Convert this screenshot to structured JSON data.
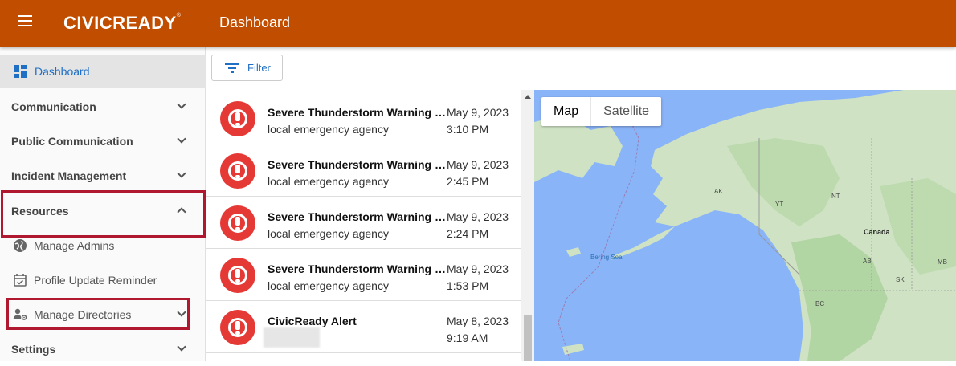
{
  "header": {
    "logo_text": "CIVICREADY",
    "logo_mark": "®",
    "page_title": "Dashboard",
    "bar_color": "#c14d00"
  },
  "sidebar": {
    "items": [
      {
        "label": "Dashboard",
        "type": "active",
        "icon": "dashboard-icon"
      },
      {
        "label": "Communication",
        "type": "section",
        "chevron": "down"
      },
      {
        "label": "Public Communication",
        "type": "section",
        "chevron": "down"
      },
      {
        "label": "Incident Management",
        "type": "section",
        "chevron": "down"
      },
      {
        "label": "Resources",
        "type": "section",
        "chevron": "up",
        "highlighted": true
      },
      {
        "label": "Manage Admins",
        "type": "sub",
        "icon": "globe-icon"
      },
      {
        "label": "Profile Update Reminder",
        "type": "sub",
        "icon": "calendar-check-icon"
      },
      {
        "label": "Manage Directories",
        "type": "sub",
        "icon": "user-gear-icon",
        "chevron": "down",
        "highlighted": true
      },
      {
        "label": "Settings",
        "type": "section",
        "chevron": "down"
      }
    ]
  },
  "toolbar": {
    "filter_label": "Filter",
    "accent": "#1f6fc5"
  },
  "alerts": [
    {
      "title": "Severe Thunderstorm Warning is…",
      "sender": "local emergency agency",
      "date": "May 9, 2023",
      "time": "3:10 PM"
    },
    {
      "title": "Severe Thunderstorm Warning is…",
      "sender": "local emergency agency",
      "date": "May 9, 2023",
      "time": "2:45 PM"
    },
    {
      "title": "Severe Thunderstorm Warning is…",
      "sender": "local emergency agency",
      "date": "May 9, 2023",
      "time": "2:24 PM"
    },
    {
      "title": "Severe Thunderstorm Warning is…",
      "sender": "local emergency agency",
      "date": "May 9, 2023",
      "time": "1:53 PM"
    },
    {
      "title": "CivicReady Alert",
      "sender": "",
      "date": "May 8, 2023",
      "time": "9:19 AM",
      "sender_redacted": true
    }
  ],
  "map": {
    "toggle_map": "Map",
    "toggle_satellite": "Satellite",
    "labels": {
      "ak": "AK",
      "yt": "YT",
      "nt": "NT",
      "bc": "BC",
      "ab": "AB",
      "sk": "SK",
      "mb": "MB",
      "canada": "Canada",
      "bering_sea": "Bering Sea"
    },
    "water_color": "#8ab4f8",
    "land_color": "#cfe3c4"
  }
}
